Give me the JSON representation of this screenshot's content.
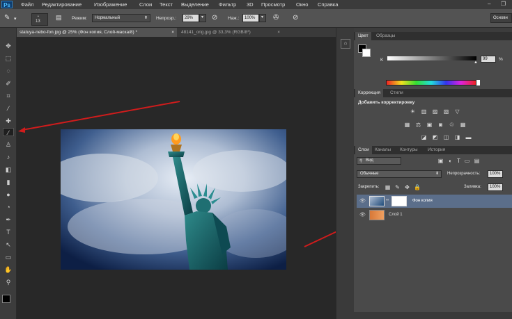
{
  "app": {
    "logo": "Ps"
  },
  "menu": [
    "Файл",
    "Редактирование",
    "Изображение",
    "Слои",
    "Текст",
    "Выделение",
    "Фильтр",
    "3D",
    "Просмотр",
    "Окно",
    "Справка"
  ],
  "options": {
    "brush_size": "13",
    "mode_label": "Режим:",
    "mode_value": "Нормальный",
    "opacity_label": "Непрозр.:",
    "opacity_value": "29%",
    "flow_label": "Наж.:",
    "flow_value": "100%",
    "workspace": "Основн"
  },
  "doc_tabs": [
    {
      "label": "statuya-nebo-fon.jpg @ 25% (Фон копия, Слой-маска/8) *",
      "active": true
    },
    {
      "label": "48141_orig.jpg @ 33,3% (RGB/8*)",
      "active": false
    }
  ],
  "color_panel": {
    "tabs": [
      "Цвет",
      "Образцы"
    ],
    "channel": "K",
    "value": "99",
    "unit": "%"
  },
  "adjust_panel": {
    "tabs": [
      "Коррекция",
      "Стили"
    ],
    "title": "Добавить корректировку"
  },
  "layers_panel": {
    "tabs": [
      "Слои",
      "Каналы",
      "Контуры",
      "История"
    ],
    "filter": "Вид",
    "blend": "Обычные",
    "opacity_label": "Непрозрачность:",
    "opacity_value": "100%",
    "lock_label": "Закрепить:",
    "fill_label": "Заливка:",
    "fill_value": "100%",
    "layers": [
      {
        "name": "Фон копия",
        "selected": true
      },
      {
        "name": "Слой 1",
        "selected": false
      }
    ]
  },
  "colors": {
    "accent_arrow": "#d01c1c",
    "selected_layer": "#5b6e8a"
  }
}
